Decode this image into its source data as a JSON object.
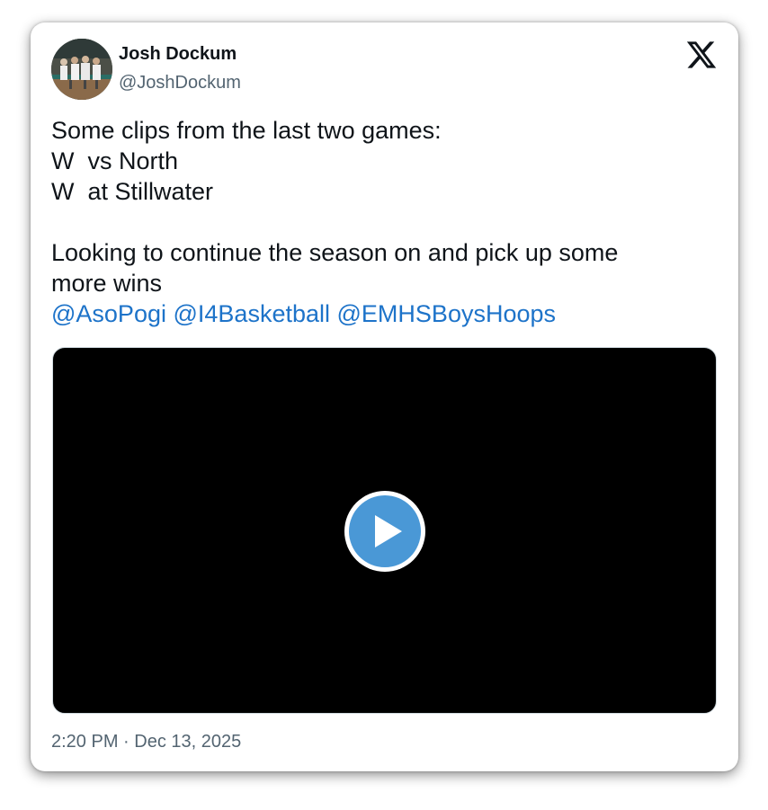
{
  "author": {
    "name": "Josh Dockum",
    "handle": "@JoshDockum",
    "avatar_icon": "basketball-team-photo"
  },
  "tweet": {
    "lines": [
      "Some clips from the last two games:",
      "W  vs North",
      "W  at Stillwater",
      "",
      "Looking to continue the season on and pick up some",
      "more wins"
    ],
    "mentions": [
      "@AsoPogi",
      "@I4Basketball",
      "@EMHSBoysHoops"
    ]
  },
  "media": {
    "type": "video",
    "play_icon": "play-icon"
  },
  "timestamp": "2:20 PM · Dec 13, 2025",
  "colors": {
    "link": "#1d73c9",
    "text": "#0f1419",
    "secondary": "#536471",
    "play_button": "#4a98d6"
  }
}
